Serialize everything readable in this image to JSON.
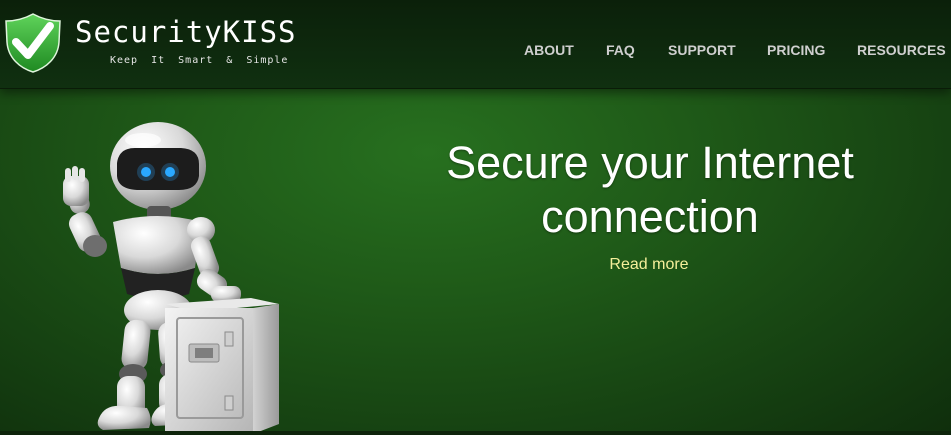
{
  "header": {
    "brand_name": "SecurityKISS",
    "tagline": "Keep It Smart & Simple"
  },
  "nav": {
    "items": [
      {
        "label": "ABOUT"
      },
      {
        "label": "FAQ"
      },
      {
        "label": "SUPPORT"
      },
      {
        "label": "PRICING"
      },
      {
        "label": "RESOURCES"
      }
    ]
  },
  "hero": {
    "title_line1": "Secure your Internet",
    "title_line2": "connection",
    "read_more": "Read more"
  },
  "colors": {
    "background_green": "#1f5a18",
    "header_dark": "#0b200a",
    "logo_green": "#3cab3a",
    "nav_text": "#cfcfcf",
    "link_yellow": "#f4ef9a",
    "robot_eye_blue": "#2aa8ff"
  },
  "icons": {
    "logo": "shield-checkmark-icon",
    "illustration": "robot-with-safe"
  }
}
